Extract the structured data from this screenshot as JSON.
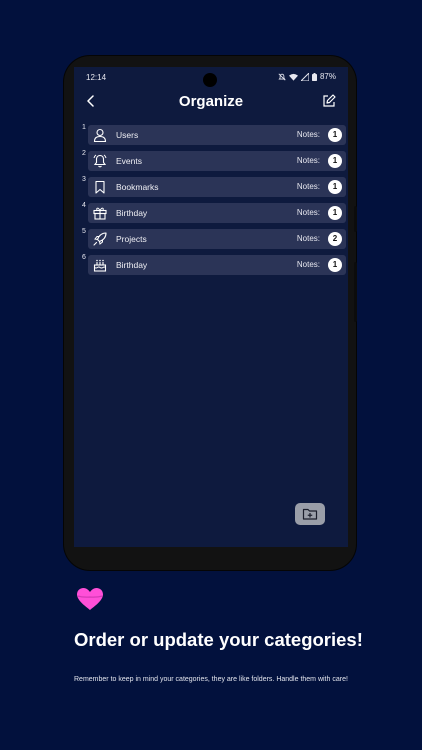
{
  "status_bar": {
    "time": "12:14",
    "battery": "87%",
    "icons": [
      "mute-icon",
      "wifi-icon",
      "signal-icon",
      "battery-icon"
    ]
  },
  "header": {
    "title": "Organize",
    "back_icon": "chevron-left-icon",
    "edit_icon": "edit-icon"
  },
  "categories": [
    {
      "number": "1",
      "name": "Users",
      "icon": "user-icon",
      "notes_label": "Notes:",
      "count": "1"
    },
    {
      "number": "2",
      "name": "Events",
      "icon": "bell-icon",
      "notes_label": "Notes:",
      "count": "1"
    },
    {
      "number": "3",
      "name": "Bookmarks",
      "icon": "bookmark-icon",
      "notes_label": "Notes:",
      "count": "1"
    },
    {
      "number": "4",
      "name": "Birthday",
      "icon": "gift-icon",
      "notes_label": "Notes:",
      "count": "1"
    },
    {
      "number": "5",
      "name": "Projects",
      "icon": "rocket-icon",
      "notes_label": "Notes:",
      "count": "2"
    },
    {
      "number": "6",
      "name": "Birthday",
      "icon": "cake-icon",
      "notes_label": "Notes:",
      "count": "1"
    }
  ],
  "fab": {
    "icon": "folder-add-icon"
  },
  "promo": {
    "heart_icon": "heart-icon",
    "headline": "Order or update your categories!",
    "subtext": "Remember to keep in mind your categories, they are like folders. Handle them with care!"
  },
  "colors": {
    "background": "#02113d",
    "screen": "#0e1a3e",
    "row": "#2b3457",
    "heart": "#ff4fd8"
  }
}
